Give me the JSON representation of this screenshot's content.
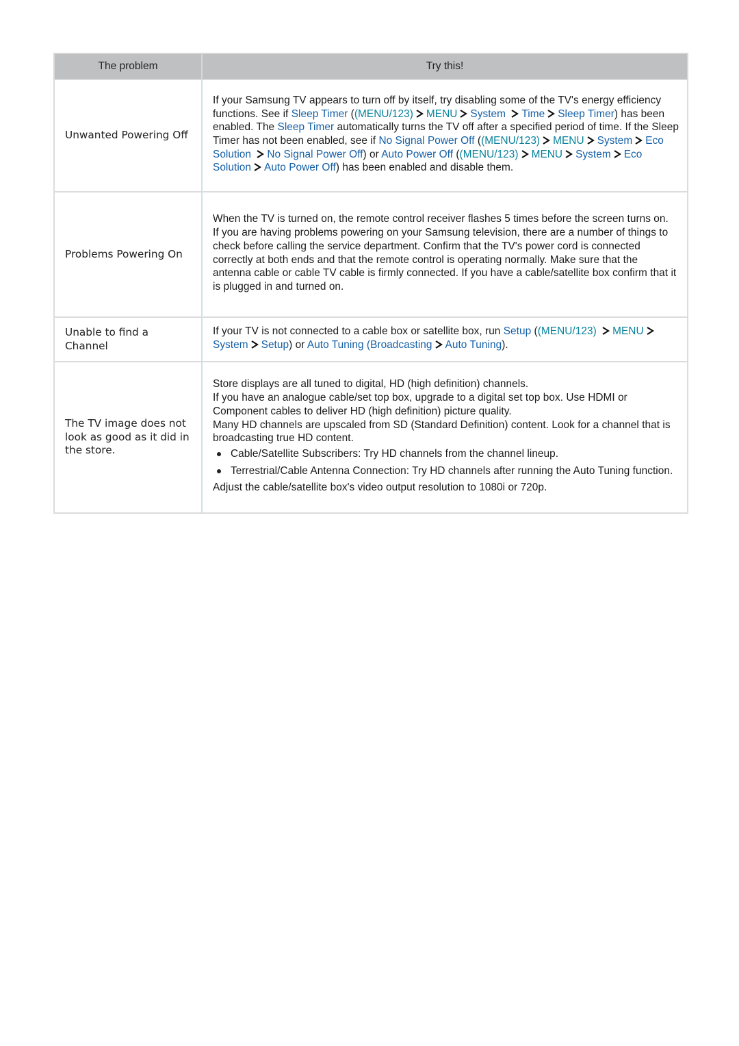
{
  "table": {
    "headers": {
      "problem": "The problem",
      "try": "Try this!"
    },
    "colors": {
      "link": "#1560a6",
      "menu": "#08829c",
      "header_bg": "#bfc0c1"
    },
    "rows": [
      {
        "problem": "Unwanted Powering Off",
        "try": {
          "t1": "If your Samsung TV appears to turn off by itself, try disabling some of the TV's energy efficiency functions. See if ",
          "l1": "Sleep Timer",
          "t2": " (",
          "m1": "(MENU/123)",
          "m2": "MENU",
          "l2": "System",
          "l3": "Time",
          "l4": "Sleep Timer",
          "t3": ") has been enabled. The ",
          "l5": "Sleep Timer",
          "t4": " automatically turns the TV off after a specified period of time. If the Sleep Timer has not been enabled, see if ",
          "l6": "No Signal Power Off",
          "t5": " (",
          "m3": "(MENU/123)",
          "m4": "MENU",
          "l7": "System",
          "l8": "Eco Solution",
          "l9": "No Signal Power Off",
          "t6": ") or ",
          "l10": "Auto Power Off",
          "t7": " (",
          "m5": "(MENU/123)",
          "m6": "MENU",
          "l11": "System",
          "l12": "Eco Solution",
          "l13": "Auto Power Off",
          "t8": ") has been enabled and disable them."
        }
      },
      {
        "problem": "Problems Powering On",
        "try": {
          "p1": "When the TV is turned on, the remote control receiver flashes 5 times before the screen turns on.",
          "p2": "If you are having problems powering on your Samsung television, there are a number of things to check before calling the service department. Confirm that the TV's power cord is connected correctly at both ends and that the remote control is operating normally. Make sure that the antenna cable or cable TV cable is firmly connected. If you have a cable/satellite box confirm that it is plugged in and turned on."
        }
      },
      {
        "problem": "Unable to find a Channel",
        "try": {
          "t1": "If your TV is not connected to a cable box or satellite box, run ",
          "l1": "Setup",
          "t2": " (",
          "m1": "(MENU/123)",
          "m2": "MENU",
          "l2": "System",
          "l3": "Setup",
          "t3": ") or ",
          "l4": "Auto Tuning",
          "t4": " ",
          "l5": "(Broadcasting",
          "l6": "Auto Tuning",
          "t5": ")."
        }
      },
      {
        "problem": "The TV image does not look as good as it did in the store.",
        "try": {
          "p1": "Store displays are all tuned to digital, HD (high definition) channels.",
          "p2": "If you have an analogue cable/set top box, upgrade to a digital set top box. Use HDMI or Component cables to deliver HD (high definition) picture quality.",
          "p3": "Many HD channels are upscaled from SD (Standard Definition) content. Look for a channel that is broadcasting true HD content.",
          "bullets": [
            "Cable/Satellite Subscribers: Try HD channels from the channel lineup.",
            "Terrestrial/Cable Antenna Connection: Try HD channels after running the Auto Tuning function."
          ],
          "p4": "Adjust the cable/satellite box's video output resolution to 1080i or 720p."
        }
      }
    ]
  },
  "icons": {
    "breadcrumb_separator": "chevron-right-icon",
    "bullet": "bullet-dot-icon"
  }
}
